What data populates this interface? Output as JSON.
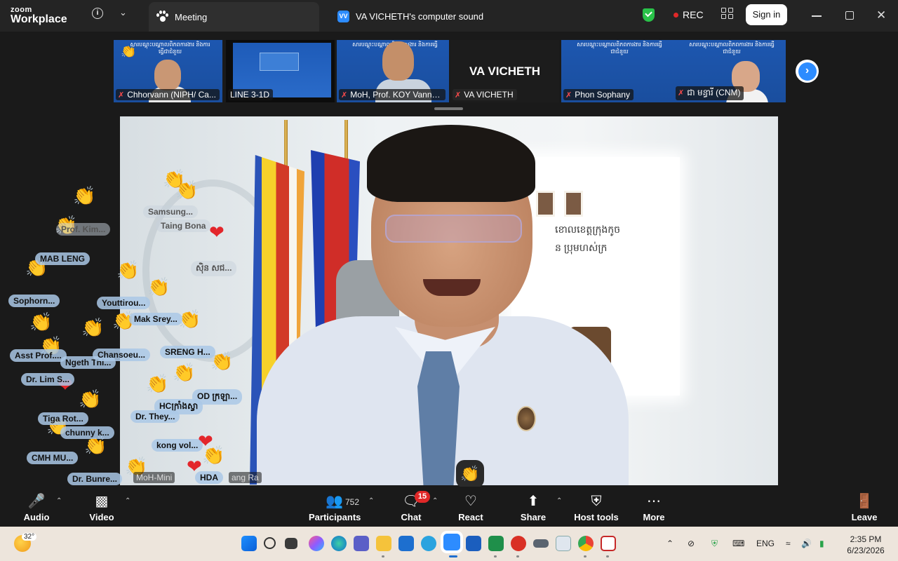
{
  "app": {
    "logo_top": "zoom",
    "logo_bottom": "Workplace"
  },
  "titlebar": {
    "tab_meeting": "Meeting",
    "share_badge": "VV",
    "share_title": "VA VICHETH's computer sound",
    "rec_label": "REC",
    "signin_label": "Sign in"
  },
  "thumbnails": [
    {
      "name": "Chhorvann (NIPH/ Ca..."
    },
    {
      "name": "LINE 3-1D"
    },
    {
      "name": "MoH, Prof. KOY Vanny,..."
    },
    {
      "name": "VA VICHETH",
      "big_label": "VA VICHETH"
    },
    {
      "name": "Phon Sophany"
    },
    {
      "name": "ជា មន្ធារី (CNM)"
    }
  ],
  "banner_text": "សារបណ្តុះបណ្តាលពិភពការងារ និងការធ្វើជាជំនួយ",
  "main_video": {
    "wall_text_line1": "ខោលខេត្តក្រុងកូច",
    "wall_text_line2": "ន ប្រុមហស់ក្រ",
    "overlay_name": "MoH-Mini",
    "overlay_name2": "ang Ra"
  },
  "reaction_tags": [
    {
      "text": "Samsung...",
      "faded": true
    },
    {
      "text": "Taing Bona",
      "faded": true
    },
    {
      "text": "Prof. Kim...",
      "faded": true
    },
    {
      "text": "MAB LENG"
    },
    {
      "text": "ស៊ិន សជ...",
      "faded": true
    },
    {
      "text": "Sophorn..."
    },
    {
      "text": "Youttirou..."
    },
    {
      "text": "Mak Srey..."
    },
    {
      "text": "Asst Prof...."
    },
    {
      "text": "Ngeth Thi..."
    },
    {
      "text": "Chansoeu..."
    },
    {
      "text": "SRENG H..."
    },
    {
      "text": "Dr. Lim S..."
    },
    {
      "text": "OD ក្រឡា..."
    },
    {
      "text": "HCក្រាំងស្វា"
    },
    {
      "text": "Dr. They..."
    },
    {
      "text": "Tiga Rot..."
    },
    {
      "text": "chunny k..."
    },
    {
      "text": "kong vol..."
    },
    {
      "text": "CMH MU..."
    },
    {
      "text": "Dr. Bunre..."
    },
    {
      "text": "HDA"
    }
  ],
  "controls": {
    "audio": "Audio",
    "video": "Video",
    "participants": "Participants",
    "participants_count": "752",
    "chat": "Chat",
    "chat_badge": "15",
    "react": "React",
    "share": "Share",
    "host_tools": "Host tools",
    "more": "More",
    "leave": "Leave"
  },
  "taskbar": {
    "temperature": "32°",
    "language": "ENG",
    "time": "2:35 PM",
    "date": "6/23/2026"
  },
  "colors": {
    "zoom_blue": "#2d8cff",
    "rec_red": "#e02828",
    "shield_green": "#29c249",
    "taskbar": "#ede5dc"
  }
}
